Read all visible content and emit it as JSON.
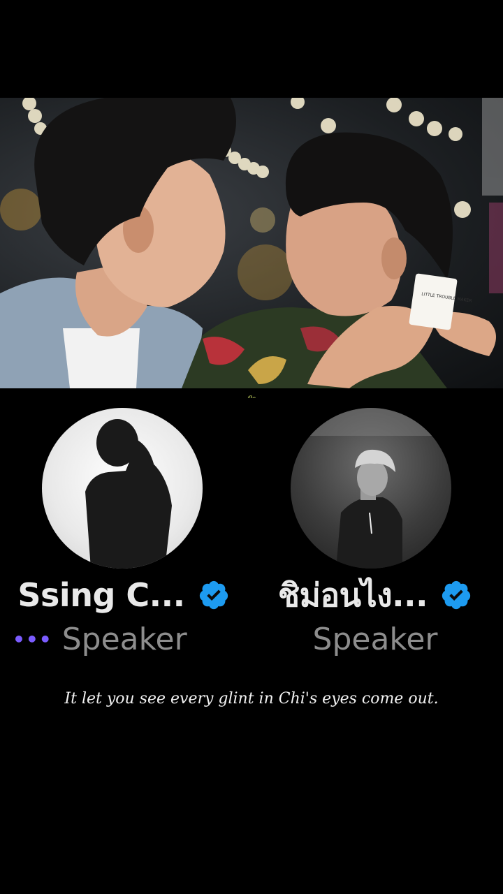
{
  "watermark": "~fls~",
  "still": {
    "card_text": "LITTLE TROUBLE MAKER"
  },
  "speakers": [
    {
      "name": "Ssing C...",
      "role": "Speaker",
      "speaking_indicator": "•••",
      "verified": true,
      "avatar": "grayscale-silhouette-avatar"
    },
    {
      "name": "ชิม่อนไง...",
      "role": "Speaker",
      "verified": true,
      "avatar": "grayscale-portrait-avatar"
    }
  ],
  "subtitle": "It let you see every glint in Chi's eyes come out.",
  "colors": {
    "background": "#000000",
    "verified_badge": "#1d9bf0",
    "speaking_dots": "#7b5cff",
    "name": "#e9e9e9",
    "role": "#8d8d8d",
    "watermark": "#d7e86b"
  }
}
